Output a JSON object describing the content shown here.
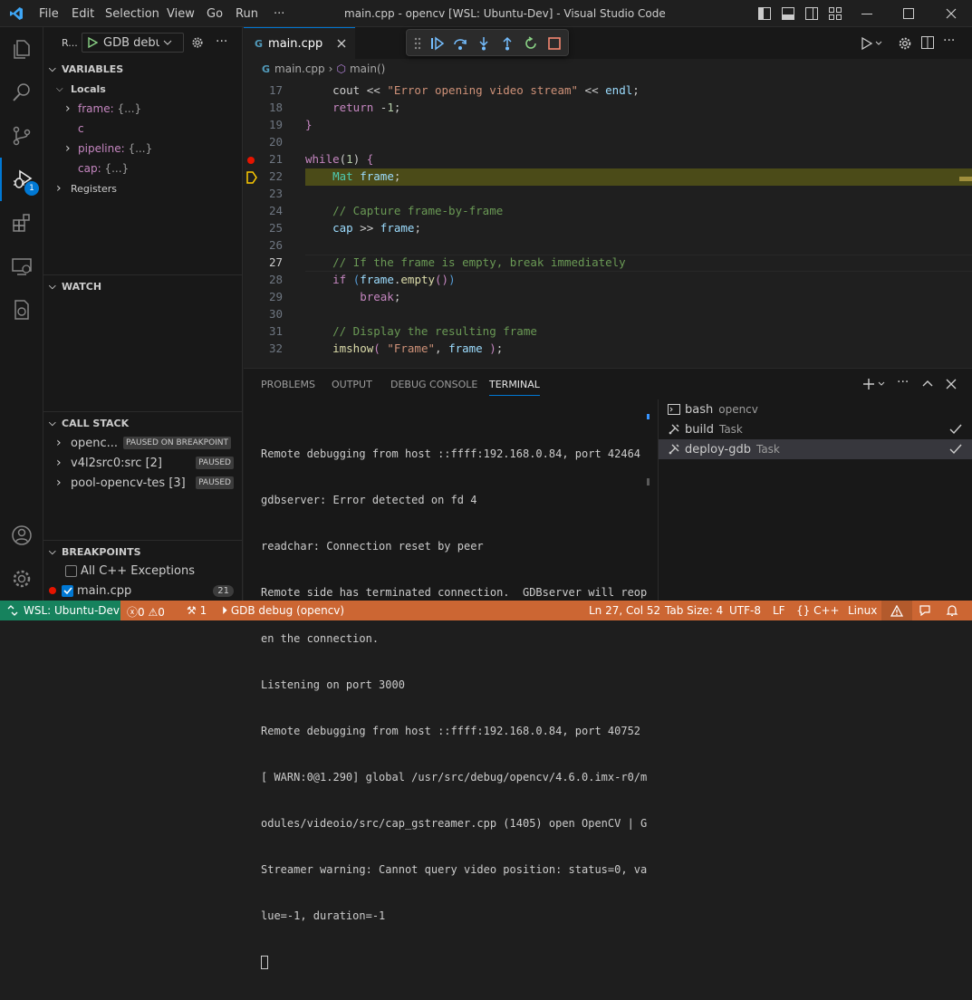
{
  "window": {
    "title": "main.cpp - opencv [WSL: Ubuntu-Dev] - Visual Studio Code",
    "menu": [
      "File",
      "Edit",
      "Selection",
      "View",
      "Go",
      "Run",
      "···"
    ]
  },
  "activity": {
    "debug_badge": "1"
  },
  "sidebar": {
    "run_label": "R...",
    "config_label": "GDB debug",
    "variables": {
      "header": "VARIABLES",
      "locals_label": "Locals",
      "items": [
        {
          "name": "frame:",
          "value": "{...}"
        },
        {
          "name": "c",
          "value": ""
        },
        {
          "name": "pipeline:",
          "value": "{...}"
        },
        {
          "name": "cap:",
          "value": "{...}"
        }
      ],
      "registers_label": "Registers"
    },
    "watch": {
      "header": "WATCH"
    },
    "call_stack": {
      "header": "CALL STACK",
      "items": [
        {
          "name": "openc...",
          "badge": "PAUSED ON BREAKPOINT"
        },
        {
          "name": "v4l2src0:src [2]",
          "badge": "PAUSED"
        },
        {
          "name": "pool-opencv-tes [3]",
          "badge": "PAUSED"
        }
      ]
    },
    "breakpoints": {
      "header": "BREAKPOINTS",
      "items": [
        {
          "label": "All C++ Exceptions",
          "count": ""
        },
        {
          "label": "main.cpp",
          "count": "21"
        }
      ]
    }
  },
  "editor": {
    "tab_label": "main.cpp",
    "breadcrumb": [
      "main.cpp",
      "main()"
    ],
    "current_line": "27",
    "paused_line": "22",
    "breakpoint_line": "21",
    "line_numbers": [
      "17",
      "18",
      "19",
      "20",
      "21",
      "22",
      "23",
      "24",
      "25",
      "26",
      "27",
      "28",
      "29",
      "30",
      "31",
      "32"
    ]
  },
  "panel": {
    "tabs": [
      "PROBLEMS",
      "OUTPUT",
      "DEBUG CONSOLE",
      "TERMINAL"
    ],
    "active_tab": "TERMINAL",
    "terminal_lines": [
      "Remote debugging from host ::ffff:192.168.0.84, port 42464",
      "gdbserver: Error detected on fd 4",
      "readchar: Connection reset by peer",
      "Remote side has terminated connection.  GDBserver will reop",
      "en the connection.",
      "Listening on port 3000",
      "Remote debugging from host ::ffff:192.168.0.84, port 40752",
      "[ WARN:0@1.290] global /usr/src/debug/opencv/4.6.0.imx-r0/m",
      "odules/videoio/src/cap_gstreamer.cpp (1405) open OpenCV | G",
      "Streamer warning: Cannot query video position: status=0, va",
      "lue=-1, duration=-1"
    ],
    "terminals": [
      {
        "name": "bash",
        "sub": "opencv"
      },
      {
        "name": "build",
        "sub": "Task"
      },
      {
        "name": "deploy-gdb",
        "sub": "Task"
      }
    ]
  },
  "status": {
    "remote": "WSL: Ubuntu-Dev",
    "errors": "0",
    "warnings": "0",
    "ports": "1",
    "debug_config": "GDB debug (opencv)",
    "position": "Ln 27, Col 52",
    "tab_size": "Tab Size: 4",
    "encoding": "UTF-8",
    "eol": "LF",
    "language": "C++",
    "platform": "Linux"
  },
  "colors": {
    "accent": "#0078d4",
    "status_bar": "#cc6633",
    "remote": "#16825d",
    "breakpoint": "#e51400",
    "paused_line": "#4b4b18"
  }
}
